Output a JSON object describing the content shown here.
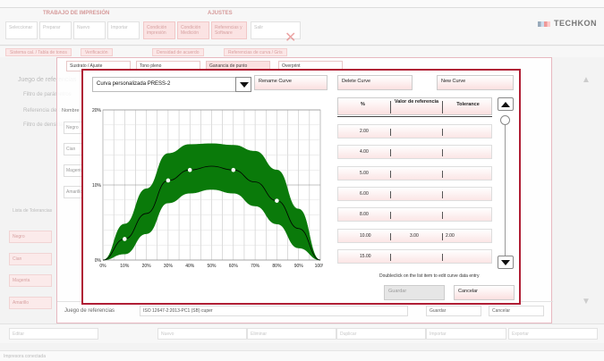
{
  "background": {
    "ribbon_groups": [
      "TRABAJO DE IMPRESIÓN",
      "AJUSTES"
    ],
    "ribbon_buttons": [
      "Seleccionar",
      "Preparar",
      "Nuevo",
      "Importar",
      "Condición impresión",
      "Condición Medición",
      "Referencias y Software",
      "Salir"
    ],
    "subtabs": [
      "Sistema cal. / Tabla de tonos",
      "Verificación",
      "Densidad de acuerdo",
      "Referencias de curva / Gris"
    ],
    "logo": "TECHKON",
    "left_labels": [
      "Juego de referencias",
      "Filtro de parámetros",
      "Referencia de color",
      "Filtro de densidad"
    ],
    "left_rows": [
      "Negro",
      "Cian",
      "Magenta",
      "Amarillo"
    ],
    "bottom_buttons": [
      "Editar",
      "Nuevo",
      "Eliminar",
      "Duplicar",
      "Importar",
      "Exportar"
    ],
    "status": "Impresora conectada",
    "section_label": "Lista de Tolerancias"
  },
  "dialog": {
    "tabs": [
      "Sustrato / Ajuste",
      "Tono pleno",
      "Ganancia de punto",
      "Overprint"
    ],
    "left_label": "Nombre",
    "left_items": [
      "Negro",
      "Cian",
      "Magenta",
      "Amarillo"
    ],
    "ref_label": "Juego de referencias",
    "ref_value": "ISO 12647-2:2013-PC1 (SB) cuper",
    "guardar": "Guardar",
    "cancelar": "Cancelar"
  },
  "modal": {
    "curve_name": "Curva personalizada PRESS-2",
    "rename_label": "Rename Curve",
    "delete_label": "Delete Curve",
    "new_label": "New Curve",
    "table_headers": [
      "%",
      "Valor de referencia",
      "Tolerance"
    ],
    "rows": [
      {
        "pct": "2.00",
        "ref": "",
        "tol": ""
      },
      {
        "pct": "4.00",
        "ref": "",
        "tol": ""
      },
      {
        "pct": "5.00",
        "ref": "",
        "tol": ""
      },
      {
        "pct": "6.00",
        "ref": "",
        "tol": ""
      },
      {
        "pct": "8.00",
        "ref": "",
        "tol": ""
      },
      {
        "pct": "10.00",
        "ref": "3.00",
        "tol": "2.00"
      },
      {
        "pct": "15.00",
        "ref": "",
        "tol": ""
      }
    ],
    "hint": "Doubleclick on the list item to edit curve data entry",
    "save_label": "Guardar",
    "cancel_label": "Cancelar"
  },
  "chart_data": {
    "type": "line",
    "title": "",
    "xlabel": "",
    "ylabel": "",
    "xlim": [
      0,
      100
    ],
    "ylim": [
      0,
      20
    ],
    "x_ticks": [
      "0%",
      "10%",
      "20%",
      "30%",
      "40%",
      "50%",
      "60%",
      "70%",
      "80%",
      "90%",
      "100%"
    ],
    "y_ticks": [
      "0%",
      "10%",
      "20%"
    ],
    "series": [
      {
        "values": [
          [
            0,
            0
          ],
          [
            10,
            2.8
          ],
          [
            20,
            6.2
          ],
          [
            30,
            10.6
          ],
          [
            40,
            12.0
          ],
          [
            50,
            12.5
          ],
          [
            60,
            12.0
          ],
          [
            70,
            10.4
          ],
          [
            80,
            7.9
          ],
          [
            90,
            4.2
          ],
          [
            100,
            0
          ]
        ]
      }
    ],
    "band_upper": [
      [
        0,
        0
      ],
      [
        10,
        4.8
      ],
      [
        20,
        9.5
      ],
      [
        30,
        14.2
      ],
      [
        40,
        15.4
      ],
      [
        50,
        15.5
      ],
      [
        60,
        15.3
      ],
      [
        70,
        14.5
      ],
      [
        80,
        12.0
      ],
      [
        90,
        6.8
      ],
      [
        100,
        0
      ]
    ],
    "band_lower": [
      [
        0,
        0
      ],
      [
        10,
        0.8
      ],
      [
        20,
        3.5
      ],
      [
        30,
        7.6
      ],
      [
        40,
        8.9
      ],
      [
        50,
        9.4
      ],
      [
        60,
        8.9
      ],
      [
        70,
        7.2
      ],
      [
        80,
        4.8
      ],
      [
        90,
        1.6
      ],
      [
        100,
        0
      ]
    ],
    "markers": [
      [
        10,
        2.8
      ],
      [
        30,
        10.6
      ],
      [
        40,
        12.0
      ],
      [
        60,
        12.0
      ],
      [
        80,
        7.9
      ]
    ],
    "band_color": "#0a7a0a",
    "line_color": "#000000"
  }
}
